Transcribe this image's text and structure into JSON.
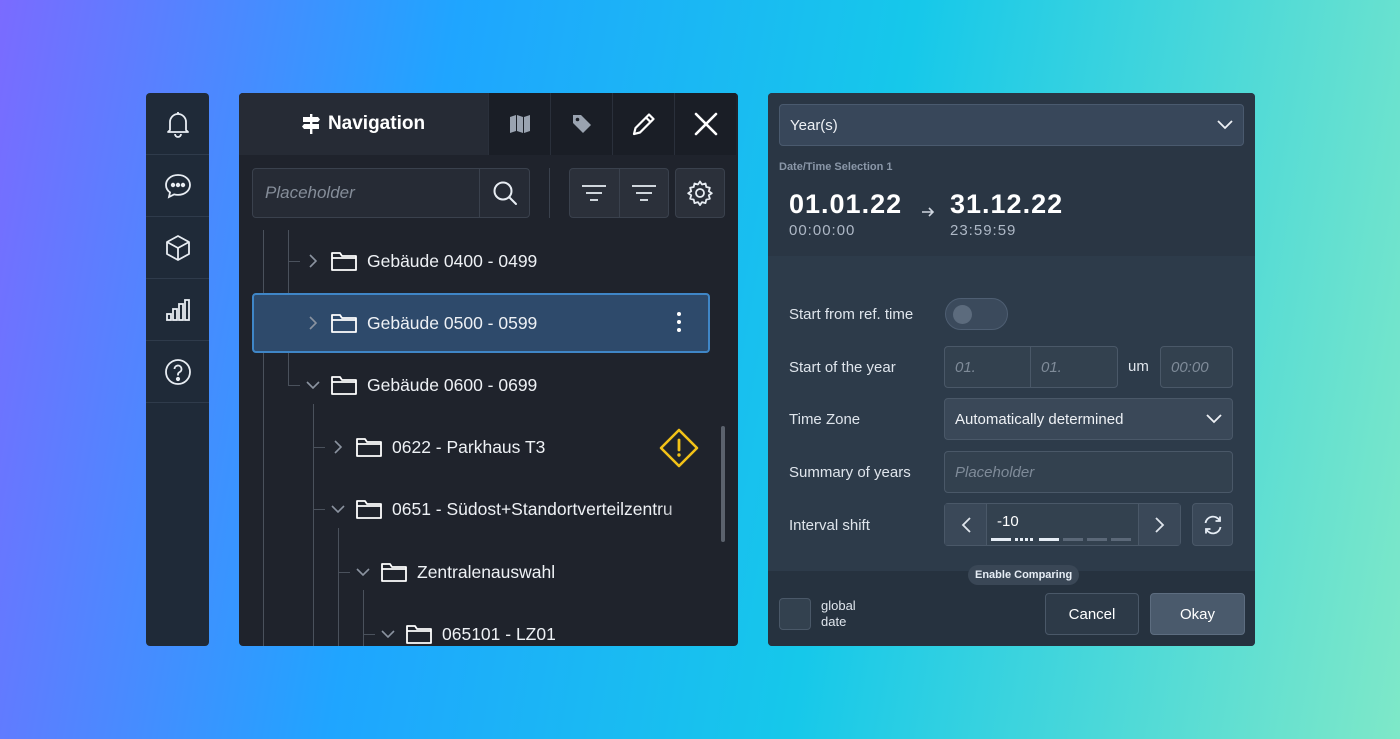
{
  "rail": {
    "items": [
      {
        "icon": "bell-icon"
      },
      {
        "icon": "chat-icon"
      },
      {
        "icon": "cube-icon"
      },
      {
        "icon": "bar-chart-icon"
      },
      {
        "icon": "help-icon"
      }
    ]
  },
  "nav": {
    "title": "Navigation",
    "tabs": [
      "map-icon",
      "tag-icon",
      "pencil-icon",
      "close-icon"
    ],
    "search_placeholder": "Placeholder",
    "tree": [
      {
        "label": "Gebäude 0400 - 0499",
        "expanded": false
      },
      {
        "label": "Gebäude 0500 - 0599",
        "expanded": false,
        "selected": true
      },
      {
        "label": "Gebäude 0600 - 0699",
        "expanded": true
      },
      {
        "label": "0622 - Parkhaus T3",
        "expanded": false,
        "warning": true
      },
      {
        "label": "0651 - Südost+Standortverteilzentru",
        "expanded": true
      },
      {
        "label": "Zentralenauswahl",
        "expanded": true
      },
      {
        "label": "065101 - LZ01",
        "expanded": true
      }
    ]
  },
  "date": {
    "period_select": "Year(s)",
    "selection_label": "Date/Time Selection 1",
    "start_date": "01.01.22",
    "start_time": "00:00:00",
    "end_date": "31.12.22",
    "end_time": "23:59:59",
    "labels": {
      "start_from_ref": "Start from ref. time",
      "start_of_year": "Start of the year",
      "time_zone": "Time Zone",
      "summary": "Summary of years",
      "interval_shift": "Interval shift"
    },
    "start_day_placeholder": "01.",
    "start_month_placeholder": "01.",
    "um": "um",
    "time_placeholder": "00:00",
    "time_zone_value": "Automatically determined",
    "summary_placeholder": "Placeholder",
    "interval_value": "-10",
    "enable_comparing": "Enable Comparing",
    "global_date": "global date",
    "cancel": "Cancel",
    "okay": "Okay"
  },
  "colors": {
    "selection_fill": "#2e4a6b",
    "selection_border": "#3f86c7",
    "warning": "#f2c218"
  }
}
